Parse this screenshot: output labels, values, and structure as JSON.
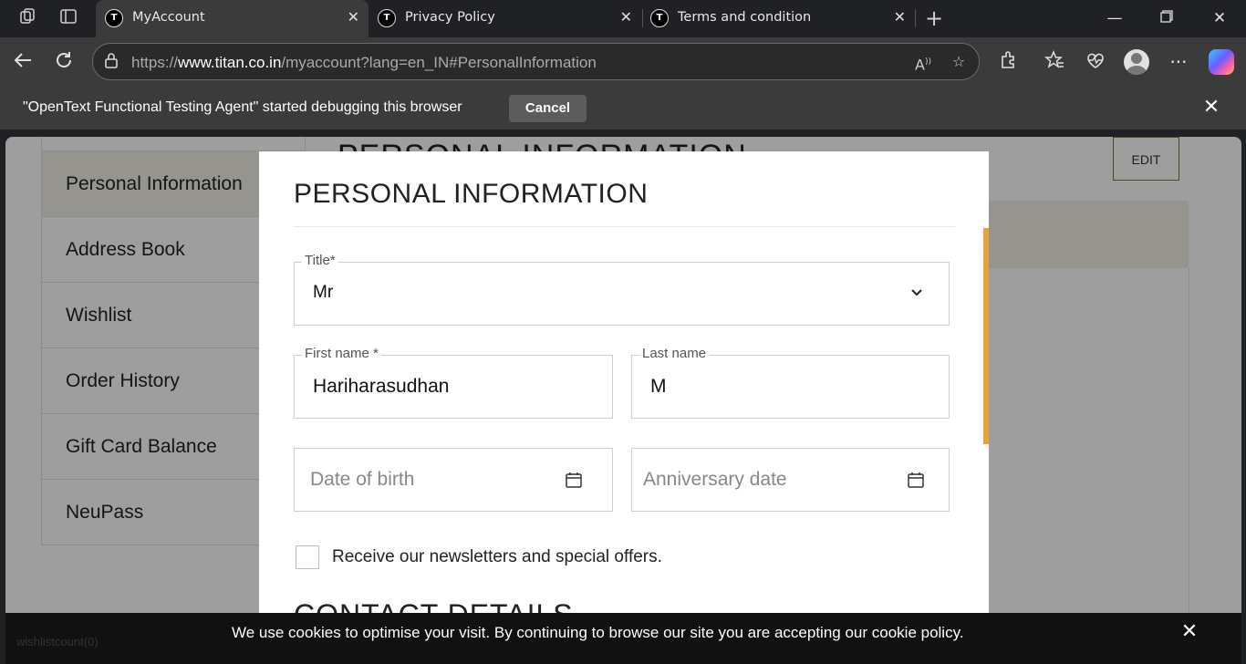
{
  "browser": {
    "tabs": [
      {
        "title": "MyAccount",
        "favicon": "titan-logo"
      },
      {
        "title": "Privacy Policy",
        "favicon": "titan-logo"
      },
      {
        "title": "Terms and condition",
        "favicon": "titan-logo"
      }
    ],
    "url_prefix": "https://",
    "url_host": "www.titan.co.in",
    "url_path": "/myaccount?lang=en_IN#PersonalInformation"
  },
  "debug_bar": {
    "message": "\"OpenText Functional Testing Agent\" started debugging this browser",
    "cancel_label": "Cancel"
  },
  "sidebar": {
    "items": [
      {
        "label": "Personal Information",
        "active": true
      },
      {
        "label": "Address Book"
      },
      {
        "label": "Wishlist"
      },
      {
        "label": "Order History"
      },
      {
        "label": "Gift Card Balance"
      },
      {
        "label": "NeuPass"
      }
    ]
  },
  "background": {
    "heading": "PERSONAL INFORMATION",
    "edit_label": "EDIT"
  },
  "modal": {
    "title": "PERSONAL INFORMATION",
    "title_field": {
      "label": "Title*",
      "value": "Mr"
    },
    "first_name": {
      "label": "First name *",
      "value": "Hariharasudhan"
    },
    "last_name": {
      "label": "Last name",
      "value": "M"
    },
    "dob": {
      "placeholder": "Date of birth"
    },
    "anniversary": {
      "placeholder": "Anniversary date"
    },
    "newsletter_label": "Receive our newsletters and special offers.",
    "contact_heading": "CONTACT DETAILS"
  },
  "cookie_bar": {
    "message": "We use cookies to optimise your visit. By continuing to browse our site you are accepting our cookie policy.",
    "faded_text": "wishlistcount(0)"
  },
  "colors": {
    "accent": "#e8a23c",
    "active_bg": "#f3efe6",
    "edit_border": "#8b6f3a"
  }
}
